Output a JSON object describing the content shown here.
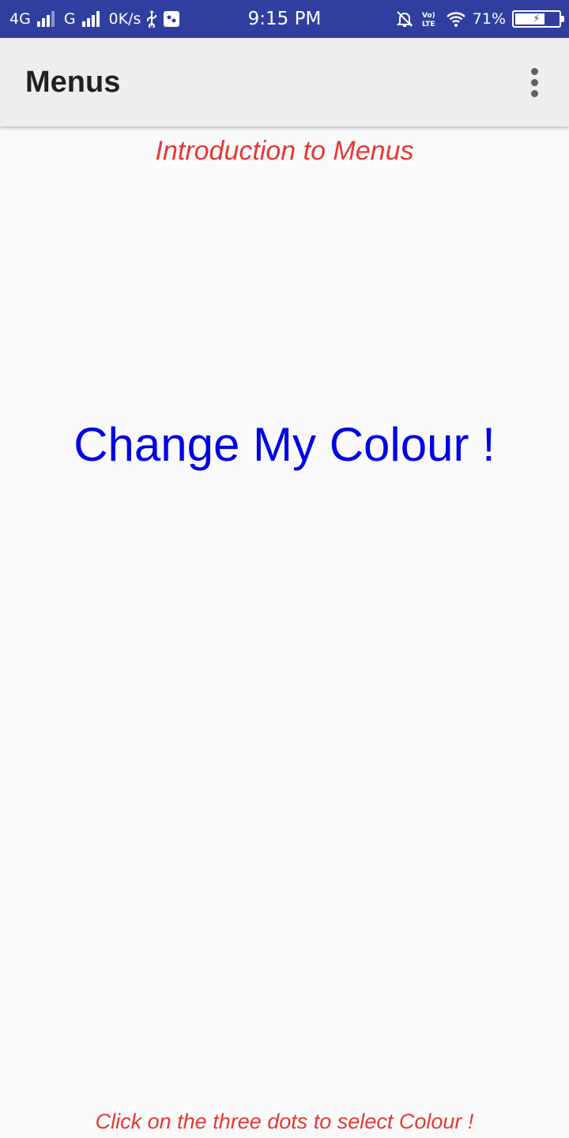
{
  "status_bar": {
    "network_1": "4G",
    "network_2": "G",
    "data_speed": "0K/s",
    "time": "9:15 PM",
    "battery_percent": "71%",
    "battery_level": 0.71,
    "icons": [
      "signal-icon",
      "usb-icon",
      "sdk-icon",
      "mute-icon",
      "volte-icon",
      "wifi-icon",
      "battery-icon"
    ]
  },
  "app_bar": {
    "title": "Menus",
    "overflow_icon": "three-dots-vertical-icon"
  },
  "content": {
    "intro": "Introduction to Menus",
    "change_text": "Change My Colour !",
    "hint": "Click on the three dots to select Colour !"
  },
  "colors": {
    "status_bar": "#303f9f",
    "app_bar": "#eeeeee",
    "accent_red": "#e53935",
    "change_text_blue": "#0000e6",
    "background": "#fafafa"
  }
}
